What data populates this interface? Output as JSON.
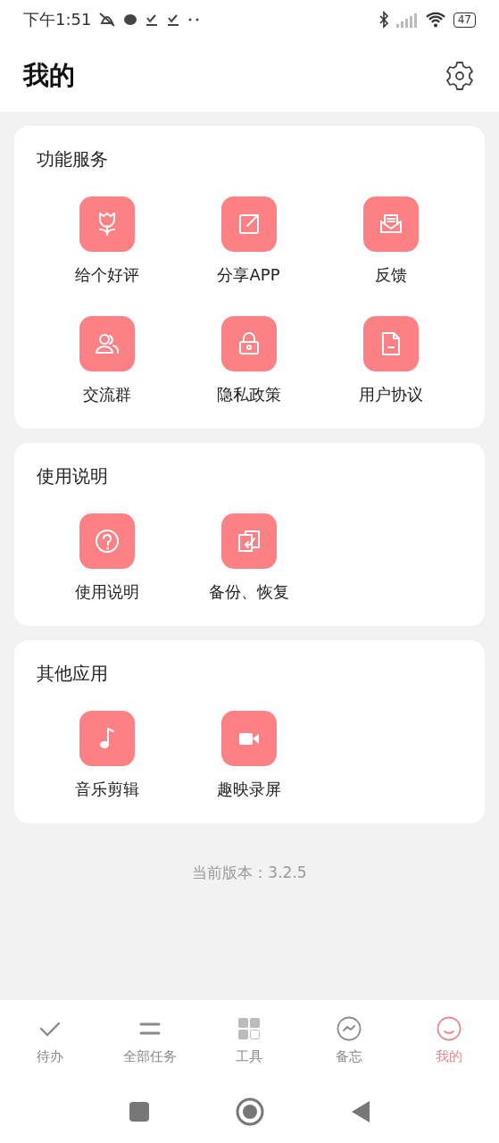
{
  "status_bar": {
    "time": "下午1:51",
    "battery": "47"
  },
  "header": {
    "title": "我的"
  },
  "sections": [
    {
      "title": "功能服务",
      "items": [
        {
          "label": "给个好评"
        },
        {
          "label": "分享APP"
        },
        {
          "label": "反馈"
        },
        {
          "label": "交流群"
        },
        {
          "label": "隐私政策"
        },
        {
          "label": "用户协议"
        }
      ]
    },
    {
      "title": "使用说明",
      "items": [
        {
          "label": "使用说明"
        },
        {
          "label": "备份、恢复"
        }
      ]
    },
    {
      "title": "其他应用",
      "items": [
        {
          "label": "音乐剪辑"
        },
        {
          "label": "趣映录屏"
        }
      ]
    }
  ],
  "version": "当前版本：3.2.5",
  "tabs": [
    {
      "label": "待办",
      "selected": false
    },
    {
      "label": "全部任务",
      "selected": false
    },
    {
      "label": "工具",
      "selected": false
    },
    {
      "label": "备忘",
      "selected": false
    },
    {
      "label": "我的",
      "selected": true
    }
  ]
}
